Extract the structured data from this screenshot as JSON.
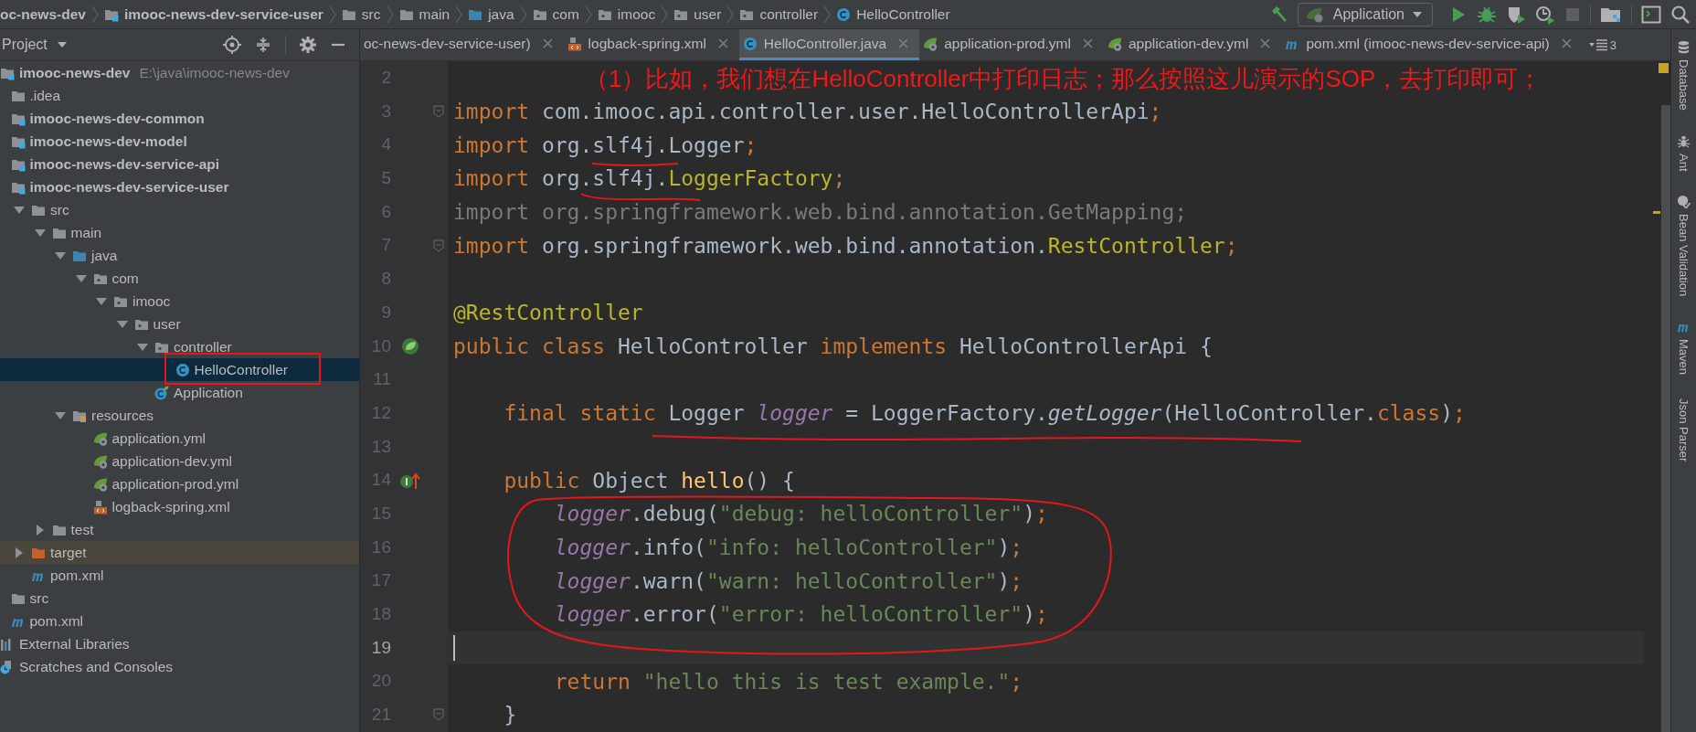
{
  "breadcrumbs": [
    {
      "label": "oc-news-dev",
      "kind": "cut"
    },
    {
      "label": "imooc-news-dev-service-user",
      "kind": "module"
    },
    {
      "label": "src",
      "kind": "folder"
    },
    {
      "label": "main",
      "kind": "folder"
    },
    {
      "label": "java",
      "kind": "source-folder"
    },
    {
      "label": "com",
      "kind": "package"
    },
    {
      "label": "imooc",
      "kind": "package"
    },
    {
      "label": "user",
      "kind": "package"
    },
    {
      "label": "controller",
      "kind": "package"
    },
    {
      "label": "HelloController",
      "kind": "class"
    }
  ],
  "run_config": {
    "label": "Application"
  },
  "project": {
    "title": "Project",
    "tree": [
      {
        "label": "imooc-news-dev",
        "kind": "module",
        "path": "E:\\java\\imooc-news-dev",
        "selected": false,
        "children": [
          {
            "label": ".idea",
            "kind": "folder",
            "selected": false
          },
          {
            "label": "imooc-news-dev-common",
            "kind": "module",
            "selected": false
          },
          {
            "label": "imooc-news-dev-model",
            "kind": "module",
            "selected": false
          },
          {
            "label": "imooc-news-dev-service-api",
            "kind": "module",
            "selected": false
          },
          {
            "label": "imooc-news-dev-service-user",
            "kind": "module",
            "selected": false,
            "children": [
              {
                "label": "src",
                "kind": "folder",
                "expanded": true,
                "selected": false,
                "children": [
                  {
                    "label": "main",
                    "kind": "folder",
                    "expanded": true,
                    "selected": false,
                    "children": [
                      {
                        "label": "java",
                        "kind": "source-folder",
                        "expanded": true,
                        "selected": false,
                        "children": [
                          {
                            "label": "com",
                            "kind": "package",
                            "expanded": true,
                            "selected": false,
                            "children": [
                              {
                                "label": "imooc",
                                "kind": "package",
                                "expanded": true,
                                "selected": false,
                                "children": [
                                  {
                                    "label": "user",
                                    "kind": "package",
                                    "expanded": true,
                                    "selected": false,
                                    "children": [
                                      {
                                        "label": "controller",
                                        "kind": "package",
                                        "expanded": true,
                                        "selected": false,
                                        "children": [
                                          {
                                            "label": "HelloController",
                                            "kind": "class",
                                            "selected": true
                                          }
                                        ]
                                      },
                                      {
                                        "label": "Application",
                                        "kind": "spring-class",
                                        "selected": false
                                      }
                                    ]
                                  }
                                ]
                              }
                            ]
                          }
                        ]
                      },
                      {
                        "label": "resources",
                        "kind": "resources-folder",
                        "expanded": true,
                        "selected": false,
                        "children": [
                          {
                            "label": "application.yml",
                            "kind": "spring-config",
                            "selected": false
                          },
                          {
                            "label": "application-dev.yml",
                            "kind": "spring-config",
                            "selected": false
                          },
                          {
                            "label": "application-prod.yml",
                            "kind": "spring-config",
                            "selected": false
                          },
                          {
                            "label": "logback-spring.xml",
                            "kind": "xml",
                            "selected": false
                          }
                        ]
                      }
                    ]
                  },
                  {
                    "label": "test",
                    "kind": "folder",
                    "expanded": false,
                    "selected": false
                  }
                ]
              },
              {
                "label": "target",
                "kind": "excluded-folder",
                "expanded": false,
                "selected": false
              },
              {
                "label": "pom.xml",
                "kind": "maven",
                "selected": false
              }
            ]
          },
          {
            "label": "src",
            "kind": "folder",
            "selected": false
          },
          {
            "label": "pom.xml",
            "kind": "maven",
            "selected": false
          }
        ]
      },
      {
        "label": "External Libraries",
        "kind": "libraries",
        "selected": false
      },
      {
        "label": "Scratches and Consoles",
        "kind": "scratches",
        "selected": false
      }
    ]
  },
  "tabs": [
    {
      "label": "oc-news-dev-service-user)",
      "kind": "cut",
      "selected": false
    },
    {
      "label": "logback-spring.xml",
      "kind": "xml",
      "selected": false
    },
    {
      "label": "HelloController.java",
      "kind": "class",
      "selected": true
    },
    {
      "label": "application-prod.yml",
      "kind": "spring-config",
      "selected": false
    },
    {
      "label": "application-dev.yml",
      "kind": "spring-config",
      "selected": false
    },
    {
      "label": "pom.xml (imooc-news-dev-service-api)",
      "kind": "maven",
      "selected": false
    }
  ],
  "tab_overflow_count": "3",
  "editor": {
    "lines": [
      {
        "number": "2",
        "fold": false,
        "current": false
      },
      {
        "number": "3",
        "fold": true,
        "current": false,
        "tokens": [
          {
            "text": "import ",
            "kind": "keyword"
          },
          {
            "text": "com.imooc.api.controller.user.HelloControllerApi",
            "kind": "plain"
          },
          {
            "text": ";",
            "kind": "keyword"
          }
        ]
      },
      {
        "number": "4",
        "fold": false,
        "current": false,
        "tokens": [
          {
            "text": "import ",
            "kind": "keyword"
          },
          {
            "text": "org.slf4j.Logger",
            "kind": "plain"
          },
          {
            "text": ";",
            "kind": "keyword"
          }
        ]
      },
      {
        "number": "5",
        "fold": false,
        "current": false,
        "tokens": [
          {
            "text": "import ",
            "kind": "keyword"
          },
          {
            "text": "org.slf4j.",
            "kind": "plain"
          },
          {
            "text": "LoggerFactory",
            "kind": "annotation"
          },
          {
            "text": ";",
            "kind": "keyword"
          }
        ]
      },
      {
        "number": "6",
        "fold": false,
        "current": false,
        "tokens": [
          {
            "text": "import org.springframework.web.bind.annotation.GetMapping;",
            "kind": "unused"
          }
        ]
      },
      {
        "number": "7",
        "fold": true,
        "current": false,
        "tokens": [
          {
            "text": "import ",
            "kind": "keyword"
          },
          {
            "text": "org.springframework.web.bind.annotation.",
            "kind": "plain"
          },
          {
            "text": "RestController",
            "kind": "annotation"
          },
          {
            "text": ";",
            "kind": "keyword"
          }
        ]
      },
      {
        "number": "8",
        "fold": false,
        "current": false
      },
      {
        "number": "9",
        "fold": false,
        "current": false,
        "tokens": [
          {
            "text": "@RestController",
            "kind": "annotation"
          }
        ]
      },
      {
        "number": "10",
        "fold": false,
        "current": false,
        "kind": "bean",
        "tokens": [
          {
            "text": "public class ",
            "kind": "keyword"
          },
          {
            "text": "HelloController ",
            "kind": "plain"
          },
          {
            "text": "implements ",
            "kind": "keyword"
          },
          {
            "text": "HelloControllerApi {",
            "kind": "plain"
          }
        ]
      },
      {
        "number": "11",
        "fold": false,
        "current": false
      },
      {
        "number": "12",
        "fold": false,
        "current": false,
        "tokens": [
          {
            "text": "    final static ",
            "kind": "keyword"
          },
          {
            "text": "Logger ",
            "kind": "plain"
          },
          {
            "text": "logger",
            "kind": "field"
          },
          {
            "text": " = LoggerFactory.",
            "kind": "plain"
          },
          {
            "text": "getLogger",
            "kind": "static"
          },
          {
            "text": "(HelloController.",
            "kind": "plain"
          },
          {
            "text": "class",
            "kind": "keyword"
          },
          {
            "text": ")",
            "kind": "plain"
          },
          {
            "text": ";",
            "kind": "keyword"
          }
        ]
      },
      {
        "number": "13",
        "fold": false,
        "current": false
      },
      {
        "number": "14",
        "fold": false,
        "current": false,
        "kind": "implements",
        "tokens": [
          {
            "text": "    public ",
            "kind": "keyword"
          },
          {
            "text": "Object ",
            "kind": "plain"
          },
          {
            "text": "hello",
            "kind": "method"
          },
          {
            "text": "() {",
            "kind": "plain"
          }
        ]
      },
      {
        "number": "15",
        "fold": false,
        "current": false,
        "tokens": [
          {
            "text": "        logger",
            "kind": "field"
          },
          {
            "text": ".debug(",
            "kind": "plain"
          },
          {
            "text": "\"debug: helloController\"",
            "kind": "string"
          },
          {
            "text": ")",
            "kind": "plain"
          },
          {
            "text": ";",
            "kind": "keyword"
          }
        ]
      },
      {
        "number": "16",
        "fold": false,
        "current": false,
        "tokens": [
          {
            "text": "        logger",
            "kind": "field"
          },
          {
            "text": ".info(",
            "kind": "plain"
          },
          {
            "text": "\"info: helloController\"",
            "kind": "string"
          },
          {
            "text": ")",
            "kind": "plain"
          },
          {
            "text": ";",
            "kind": "keyword"
          }
        ]
      },
      {
        "number": "17",
        "fold": false,
        "current": false,
        "tokens": [
          {
            "text": "        logger",
            "kind": "field"
          },
          {
            "text": ".warn(",
            "kind": "plain"
          },
          {
            "text": "\"warn: helloController\"",
            "kind": "string"
          },
          {
            "text": ")",
            "kind": "plain"
          },
          {
            "text": ";",
            "kind": "keyword"
          }
        ]
      },
      {
        "number": "18",
        "fold": false,
        "current": false,
        "tokens": [
          {
            "text": "        logger",
            "kind": "field"
          },
          {
            "text": ".error(",
            "kind": "plain"
          },
          {
            "text": "\"error: helloController\"",
            "kind": "string"
          },
          {
            "text": ")",
            "kind": "plain"
          },
          {
            "text": ";",
            "kind": "keyword"
          }
        ]
      },
      {
        "number": "19",
        "fold": false,
        "current": true
      },
      {
        "number": "20",
        "fold": false,
        "current": false,
        "tokens": [
          {
            "text": "        return ",
            "kind": "keyword"
          },
          {
            "text": "\"hello this is test example.\"",
            "kind": "string"
          },
          {
            "text": ";",
            "kind": "keyword"
          }
        ]
      },
      {
        "number": "21",
        "fold": true,
        "current": false,
        "tokens": [
          {
            "text": "    }",
            "kind": "plain"
          }
        ]
      }
    ]
  },
  "tool_windows": [
    {
      "label": "Database",
      "kind": "database"
    },
    {
      "label": "Ant",
      "kind": "ant"
    },
    {
      "label": "Bean Validation",
      "kind": "bean"
    },
    {
      "label": "Maven",
      "kind": "maven"
    },
    {
      "label": "Json Parser",
      "kind": "plain"
    }
  ],
  "annotation": {
    "note": "（1）比如，我们想在HelloController中打印日志；那么按照这儿演示的SOP，去打印即可；"
  }
}
